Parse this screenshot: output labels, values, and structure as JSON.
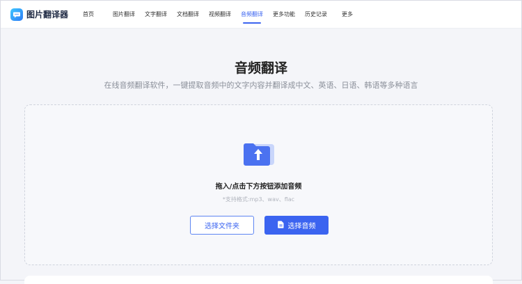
{
  "brand": {
    "name": "图片翻译器",
    "icon": "chat-bubble-icon",
    "gradient": [
      "#3ec6ff",
      "#2d7cf6"
    ]
  },
  "nav": {
    "items": [
      {
        "label": "首页",
        "active": false
      },
      {
        "label": "图片翻译",
        "active": false
      },
      {
        "label": "文字翻译",
        "active": false
      },
      {
        "label": "文档翻译",
        "active": false
      },
      {
        "label": "视频翻译",
        "active": false
      },
      {
        "label": "音频翻译",
        "active": true
      },
      {
        "label": "更多功能",
        "active": false
      },
      {
        "label": "历史记录",
        "active": false
      },
      {
        "label": "更多",
        "active": false
      }
    ]
  },
  "main": {
    "title": "音频翻译",
    "subtitle": "在线音频翻译软件，一键提取音频中的文字内容并翻译成中文、英语、日语、韩语等多种语言"
  },
  "upload": {
    "icon": "folder-upload-icon",
    "drop_label": "拖入/点击下方按钮添加音频",
    "supported_formats": "*支持格式:mp3、wav、flac",
    "select_folder_label": "选择文件夹",
    "select_audio_label": "选择音频",
    "select_audio_icon": "file-icon"
  },
  "colors": {
    "accent": "#3b64f0",
    "background": "#f4f5f9",
    "title": "#222222",
    "muted": "#8a8f99"
  }
}
